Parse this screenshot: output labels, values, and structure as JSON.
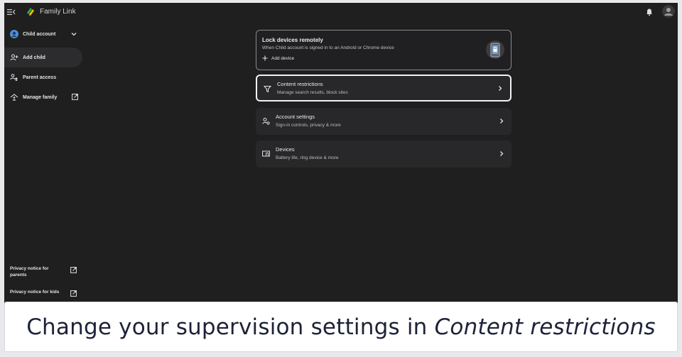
{
  "header": {
    "app_title": "Family Link",
    "icons": [
      "menu-icon",
      "family-link-logo-icon",
      "bell-icon",
      "avatar"
    ]
  },
  "sidebar": {
    "account_switcher": "Child account",
    "items": [
      {
        "label": "Add child",
        "icon": "add-person-icon",
        "active": true
      },
      {
        "label": "Parent access",
        "icon": "parent-access-icon",
        "active": false
      },
      {
        "label": "Manage family",
        "icon": "home-icon",
        "external": true,
        "active": false
      }
    ],
    "footer_links": [
      {
        "label": "Privacy notice for parents",
        "external": true
      },
      {
        "label": "Privacy notice for kids",
        "external": true
      }
    ]
  },
  "lock_card": {
    "title": "Lock devices remotely",
    "subtitle": "When Child account is signed in to an Android or Chrome device",
    "action": "Add device"
  },
  "rows": [
    {
      "title": "Content restrictions",
      "subtitle": "Manage search results, block sites",
      "icon": "filter-icon",
      "selected": true
    },
    {
      "title": "Account settings",
      "subtitle": "Sign-in controls, privacy & more",
      "icon": "account-settings-icon",
      "selected": false
    },
    {
      "title": "Devices",
      "subtitle": "Battery life, ring device & more",
      "icon": "devices-icon",
      "selected": false
    }
  ],
  "caption": {
    "prefix": "Change your supervision settings in ",
    "emphasis": "Content restrictions"
  },
  "colors": {
    "background": "#1f1f1f",
    "card": "#28282a",
    "accent_avatar": "#4a90d9"
  }
}
